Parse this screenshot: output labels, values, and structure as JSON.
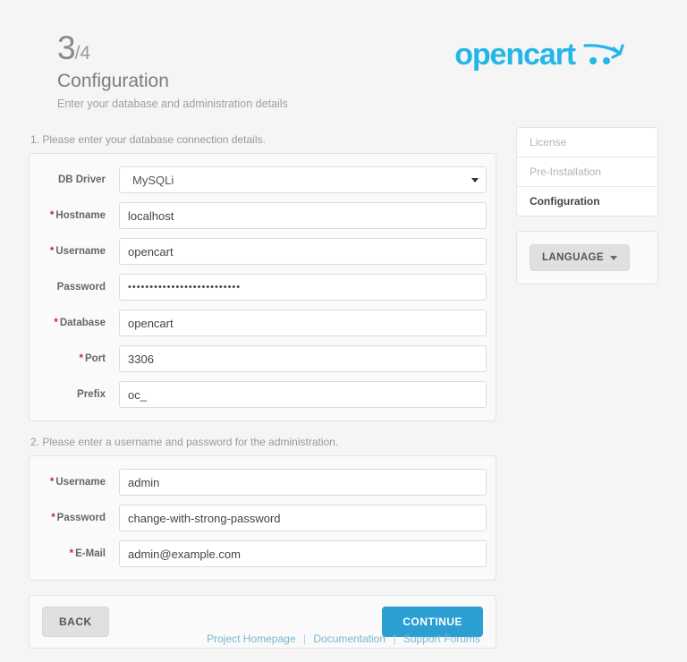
{
  "header": {
    "step_number": "3",
    "step_total": "/4",
    "title": "Configuration",
    "subtitle": "Enter your database and administration details",
    "logo_text": "opencart",
    "logo_color": "#23b6e8"
  },
  "database_section": {
    "note": "1. Please enter your database connection details.",
    "fields": [
      {
        "label": "DB Driver",
        "required": false,
        "type": "select",
        "value": "MySQLi"
      },
      {
        "label": "Hostname",
        "required": true,
        "type": "text",
        "value": "localhost"
      },
      {
        "label": "Username",
        "required": true,
        "type": "text",
        "value": "opencart"
      },
      {
        "label": "Password",
        "required": false,
        "type": "password",
        "value": "••••••••••••••••••••••••••"
      },
      {
        "label": "Database",
        "required": true,
        "type": "text",
        "value": "opencart"
      },
      {
        "label": "Port",
        "required": true,
        "type": "text",
        "value": "3306"
      },
      {
        "label": "Prefix",
        "required": false,
        "type": "text",
        "value": "oc_"
      }
    ]
  },
  "admin_section": {
    "note": "2. Please enter a username and password for the administration.",
    "fields": [
      {
        "label": "Username",
        "required": true,
        "type": "text",
        "value": "admin"
      },
      {
        "label": "Password",
        "required": true,
        "type": "text",
        "value": "change-with-strong-password"
      },
      {
        "label": "E-Mail",
        "required": true,
        "type": "text",
        "value": "admin@example.com"
      }
    ]
  },
  "sidebar": {
    "steps": [
      {
        "label": "License",
        "active": false
      },
      {
        "label": "Pre-Installation",
        "active": false
      },
      {
        "label": "Configuration",
        "active": true
      }
    ],
    "language_button": "LANGUAGE"
  },
  "actions": {
    "back_label": "BACK",
    "continue_label": "CONTINUE",
    "continue_color": "#2b9fd1"
  },
  "footer": {
    "links": [
      "Project Homepage",
      "Documentation",
      "Support Forums"
    ],
    "separator": "|"
  }
}
